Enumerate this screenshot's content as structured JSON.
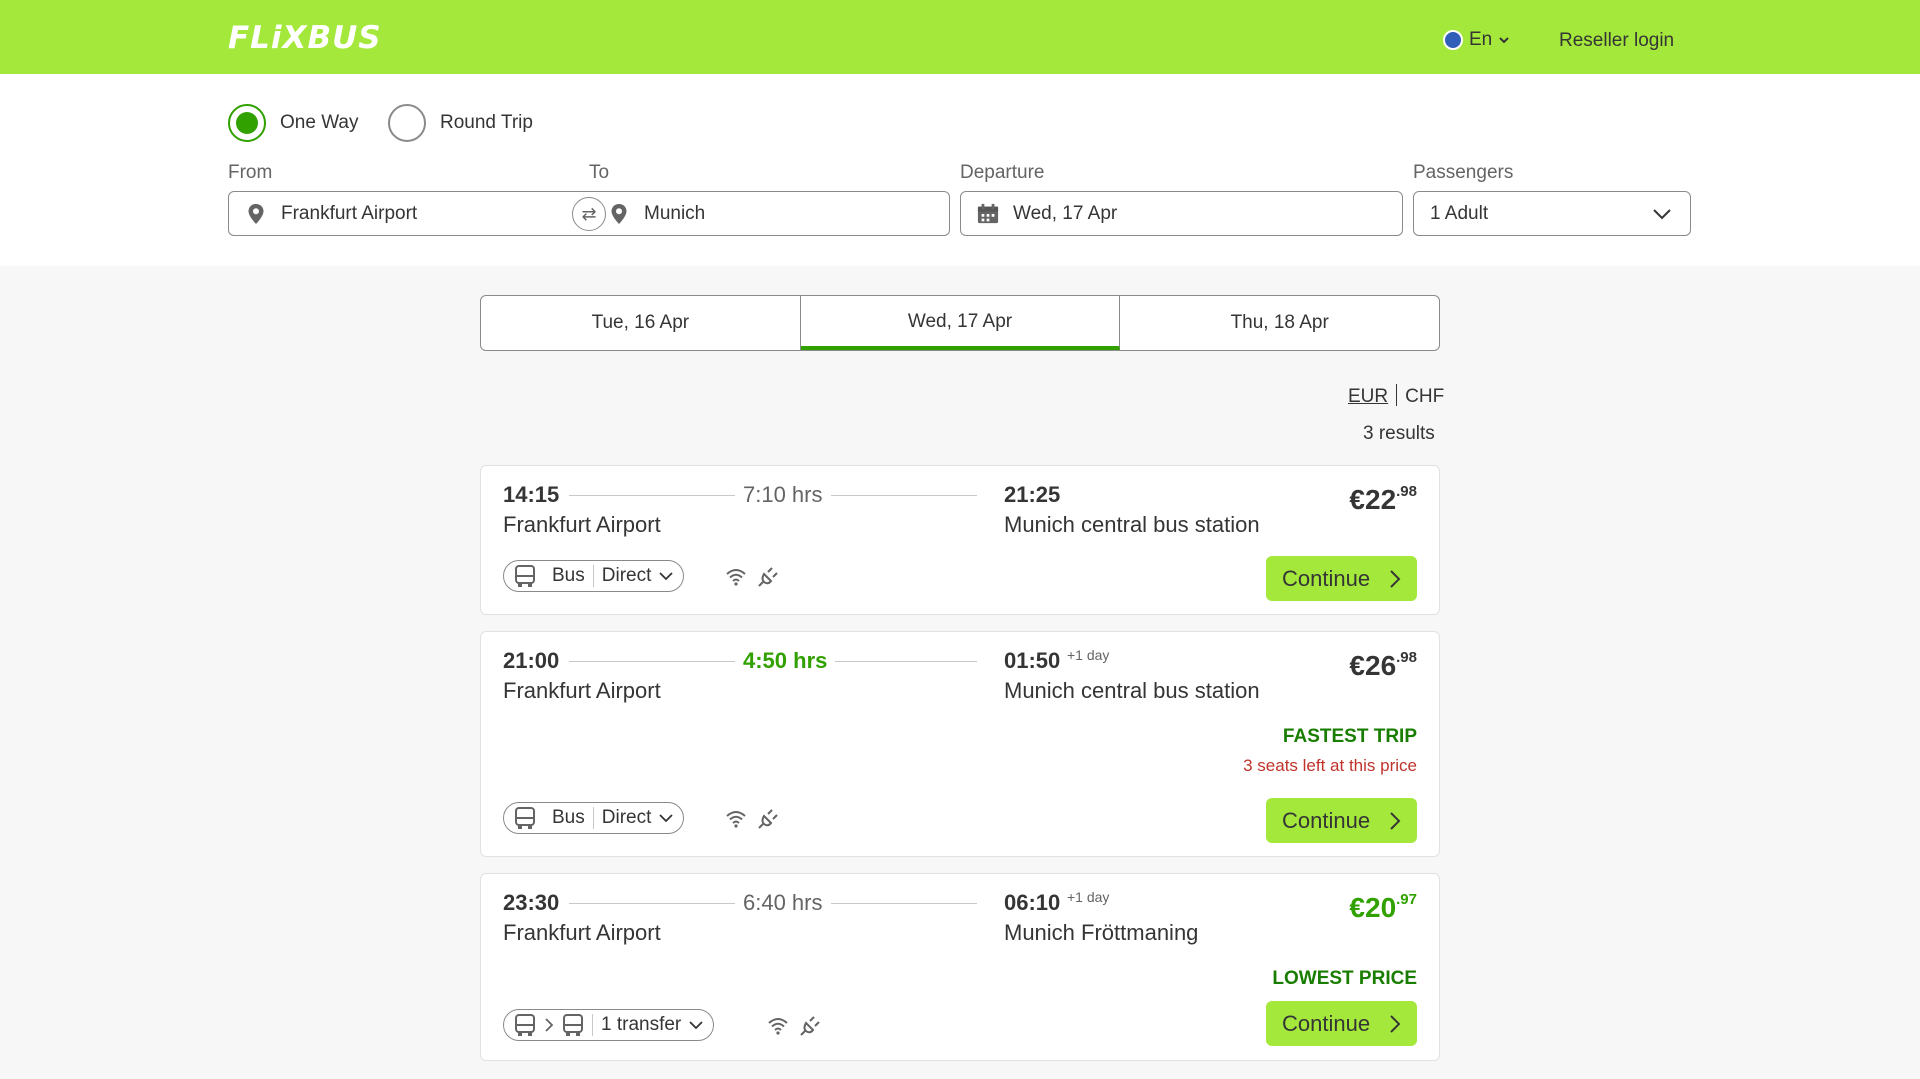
{
  "header": {
    "logo": "FLiXBUS",
    "language": "En",
    "reseller_login": "Reseller login"
  },
  "search": {
    "trip_types": [
      {
        "label": "One Way",
        "selected": true
      },
      {
        "label": "Round Trip",
        "selected": false
      }
    ],
    "from_label": "From",
    "from_value": "Frankfurt Airport",
    "to_label": "To",
    "to_value": "Munich",
    "departure_label": "Departure",
    "departure_value": "Wed, 17 Apr",
    "passengers_label": "Passengers",
    "passengers_value": "1 Adult"
  },
  "date_tabs": [
    {
      "label": "Tue, 16 Apr",
      "active": false
    },
    {
      "label": "Wed, 17 Apr",
      "active": true
    },
    {
      "label": "Thu, 18 Apr",
      "active": false
    }
  ],
  "currency": {
    "primary": "EUR",
    "secondary": "CHF"
  },
  "results_count": "3 results",
  "trips": [
    {
      "dep_time": "14:15",
      "dep_station": "Frankfurt Airport",
      "duration": "7:10 hrs",
      "arr_time": "21:25",
      "arr_plus": "",
      "arr_station": "Munich central bus station",
      "price_main": "€22",
      "price_cents": ".98",
      "badge": "",
      "seats": "",
      "mode": "Bus",
      "connection": "Direct",
      "continue": "Continue"
    },
    {
      "dep_time": "21:00",
      "dep_station": "Frankfurt Airport",
      "duration": "4:50 hrs",
      "arr_time": "01:50",
      "arr_plus": "+1 day",
      "arr_station": "Munich central bus station",
      "price_main": "€26",
      "price_cents": ".98",
      "badge": "FASTEST TRIP",
      "seats": "3 seats left at this price",
      "mode": "Bus",
      "connection": "Direct",
      "continue": "Continue"
    },
    {
      "dep_time": "23:30",
      "dep_station": "Frankfurt Airport",
      "duration": "6:40 hrs",
      "arr_time": "06:10",
      "arr_plus": "+1 day",
      "arr_station": "Munich Fröttmaning",
      "price_main": "€20",
      "price_cents": ".97",
      "badge": "LOWEST PRICE",
      "seats": "",
      "mode": "",
      "connection": "1 transfer",
      "continue": "Continue"
    }
  ],
  "colors": {
    "brand_green": "#a3e83b",
    "accent_green": "#31a100",
    "badge_green": "#187d00",
    "warning_red": "#c0332b"
  }
}
